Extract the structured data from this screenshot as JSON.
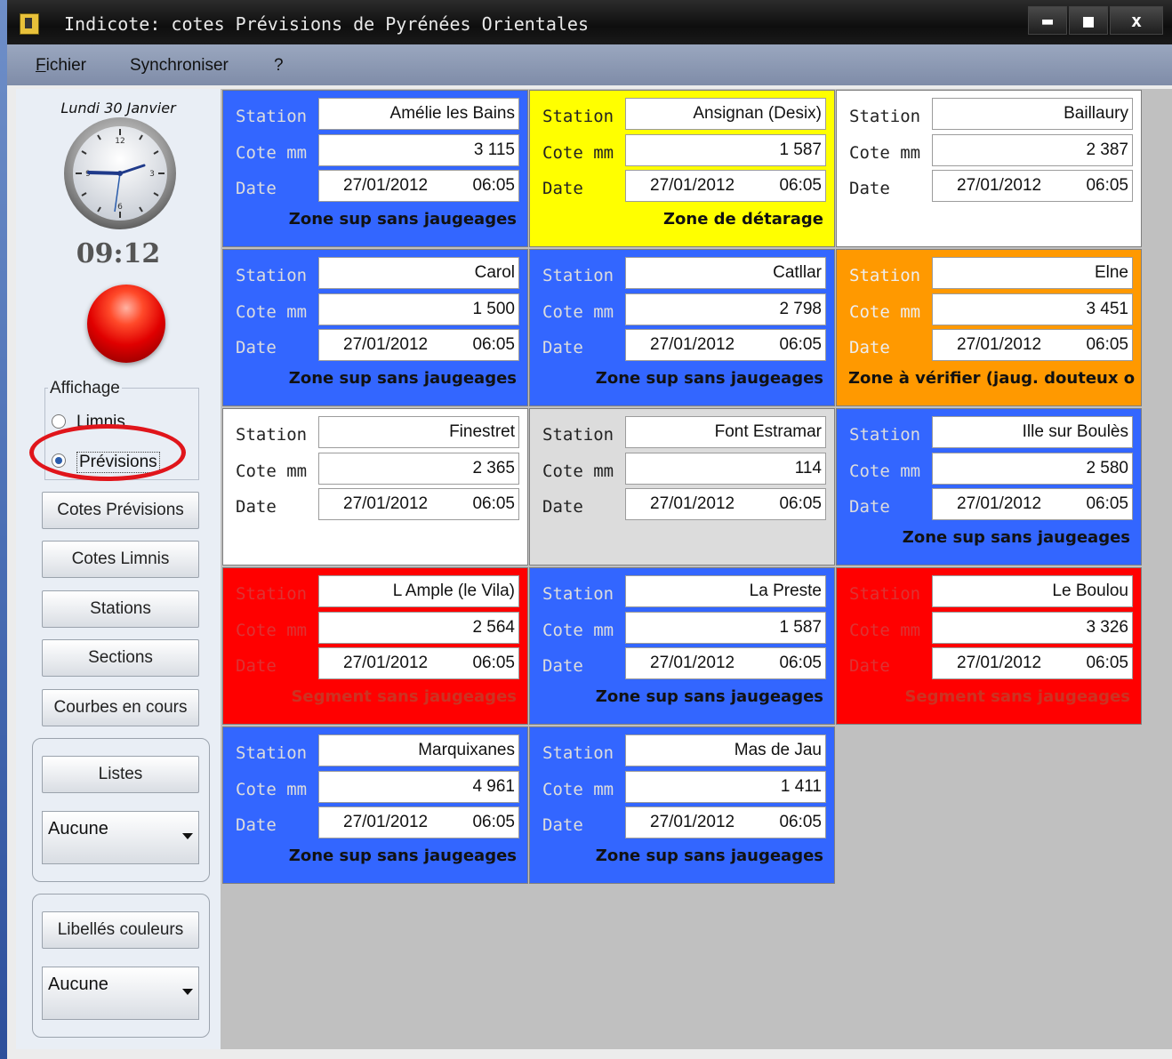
{
  "window": {
    "title": "Indicote:  cotes Prévisions de Pyrénées Orientales",
    "controls": {
      "minimize": "▬",
      "maximize": "■",
      "close": "x"
    }
  },
  "menu": {
    "items": [
      "Fichier",
      "Synchroniser",
      "?"
    ]
  },
  "sidebar": {
    "date": "Lundi 30 Janvier",
    "time": "09:12",
    "led_color": "#e00000",
    "affichage": {
      "legend": "Affichage",
      "options": [
        {
          "label": "Limnis",
          "checked": false
        },
        {
          "label": "Prévisions",
          "checked": true
        }
      ]
    },
    "buttons": [
      "Cotes Prévisions",
      "Cotes Limnis",
      "Stations",
      "Sections",
      "Courbes en cours"
    ],
    "listes": {
      "button": "Listes",
      "select_value": "Aucune"
    },
    "libelles": {
      "button": "Libellés couleurs",
      "select_value": "Aucune"
    }
  },
  "labels": {
    "station": "Station",
    "cote": "Cote mm",
    "date": "Date"
  },
  "stations": [
    {
      "name": "Amélie les Bains",
      "cote": "3 115",
      "date": "27/01/2012",
      "time": "06:05",
      "zone": "Zone sup sans jaugeages",
      "bg": "#3366ff",
      "label_color": "#dddddd",
      "zone_color": "#111111"
    },
    {
      "name": "Ansignan (Desix)",
      "cote": "1 587",
      "date": "27/01/2012",
      "time": "06:05",
      "zone": "Zone de détarage",
      "bg": "#ffff00",
      "label_color": "#222222",
      "zone_color": "#111111"
    },
    {
      "name": "Baillaury",
      "cote": "2 387",
      "date": "27/01/2012",
      "time": "06:05",
      "zone": "",
      "bg": "#ffffff",
      "label_color": "#222222",
      "zone_color": "#111111"
    },
    {
      "name": "Carol",
      "cote": "1 500",
      "date": "27/01/2012",
      "time": "06:05",
      "zone": "Zone sup sans jaugeages",
      "bg": "#3366ff",
      "label_color": "#dddddd",
      "zone_color": "#111111"
    },
    {
      "name": "Catllar",
      "cote": "2 798",
      "date": "27/01/2012",
      "time": "06:05",
      "zone": "Zone sup sans jaugeages",
      "bg": "#3366ff",
      "label_color": "#dddddd",
      "zone_color": "#111111"
    },
    {
      "name": "Elne",
      "cote": "3 451",
      "date": "27/01/2012",
      "time": "06:05",
      "zone": "Zone à vérifier (jaug. douteux o",
      "bg": "#ff9900",
      "label_color": "#eeeeee",
      "zone_color": "#111111"
    },
    {
      "name": "Finestret",
      "cote": "2 365",
      "date": "27/01/2012",
      "time": "06:05",
      "zone": "",
      "bg": "#ffffff",
      "label_color": "#222222",
      "zone_color": "#111111"
    },
    {
      "name": "Font Estramar",
      "cote": "114",
      "date": "27/01/2012",
      "time": "06:05",
      "zone": "",
      "bg": "#dcdcdc",
      "label_color": "#222222",
      "zone_color": "#111111"
    },
    {
      "name": "Ille sur Boulès",
      "cote": "2 580",
      "date": "27/01/2012",
      "time": "06:05",
      "zone": "Zone sup sans jaugeages",
      "bg": "#3366ff",
      "label_color": "#dddddd",
      "zone_color": "#111111"
    },
    {
      "name": "L Ample (le Vila)",
      "cote": "2 564",
      "date": "27/01/2012",
      "time": "06:05",
      "zone": "Segment sans jaugeages",
      "bg": "#ff0000",
      "label_color": "#dd3333",
      "zone_color": "#cc3322"
    },
    {
      "name": "La Preste",
      "cote": "1 587",
      "date": "27/01/2012",
      "time": "06:05",
      "zone": "Zone sup sans jaugeages",
      "bg": "#3366ff",
      "label_color": "#dddddd",
      "zone_color": "#111111"
    },
    {
      "name": "Le Boulou",
      "cote": "3 326",
      "date": "27/01/2012",
      "time": "06:05",
      "zone": "Segment sans jaugeages",
      "bg": "#ff0000",
      "label_color": "#dd3333",
      "zone_color": "#cc3322"
    },
    {
      "name": "Marquixanes",
      "cote": "4 961",
      "date": "27/01/2012",
      "time": "06:05",
      "zone": "Zone sup sans jaugeages",
      "bg": "#3366ff",
      "label_color": "#dddddd",
      "zone_color": "#111111"
    },
    {
      "name": "Mas de Jau",
      "cote": "1 411",
      "date": "27/01/2012",
      "time": "06:05",
      "zone": "Zone sup sans jaugeages",
      "bg": "#3366ff",
      "label_color": "#dddddd",
      "zone_color": "#111111"
    }
  ]
}
